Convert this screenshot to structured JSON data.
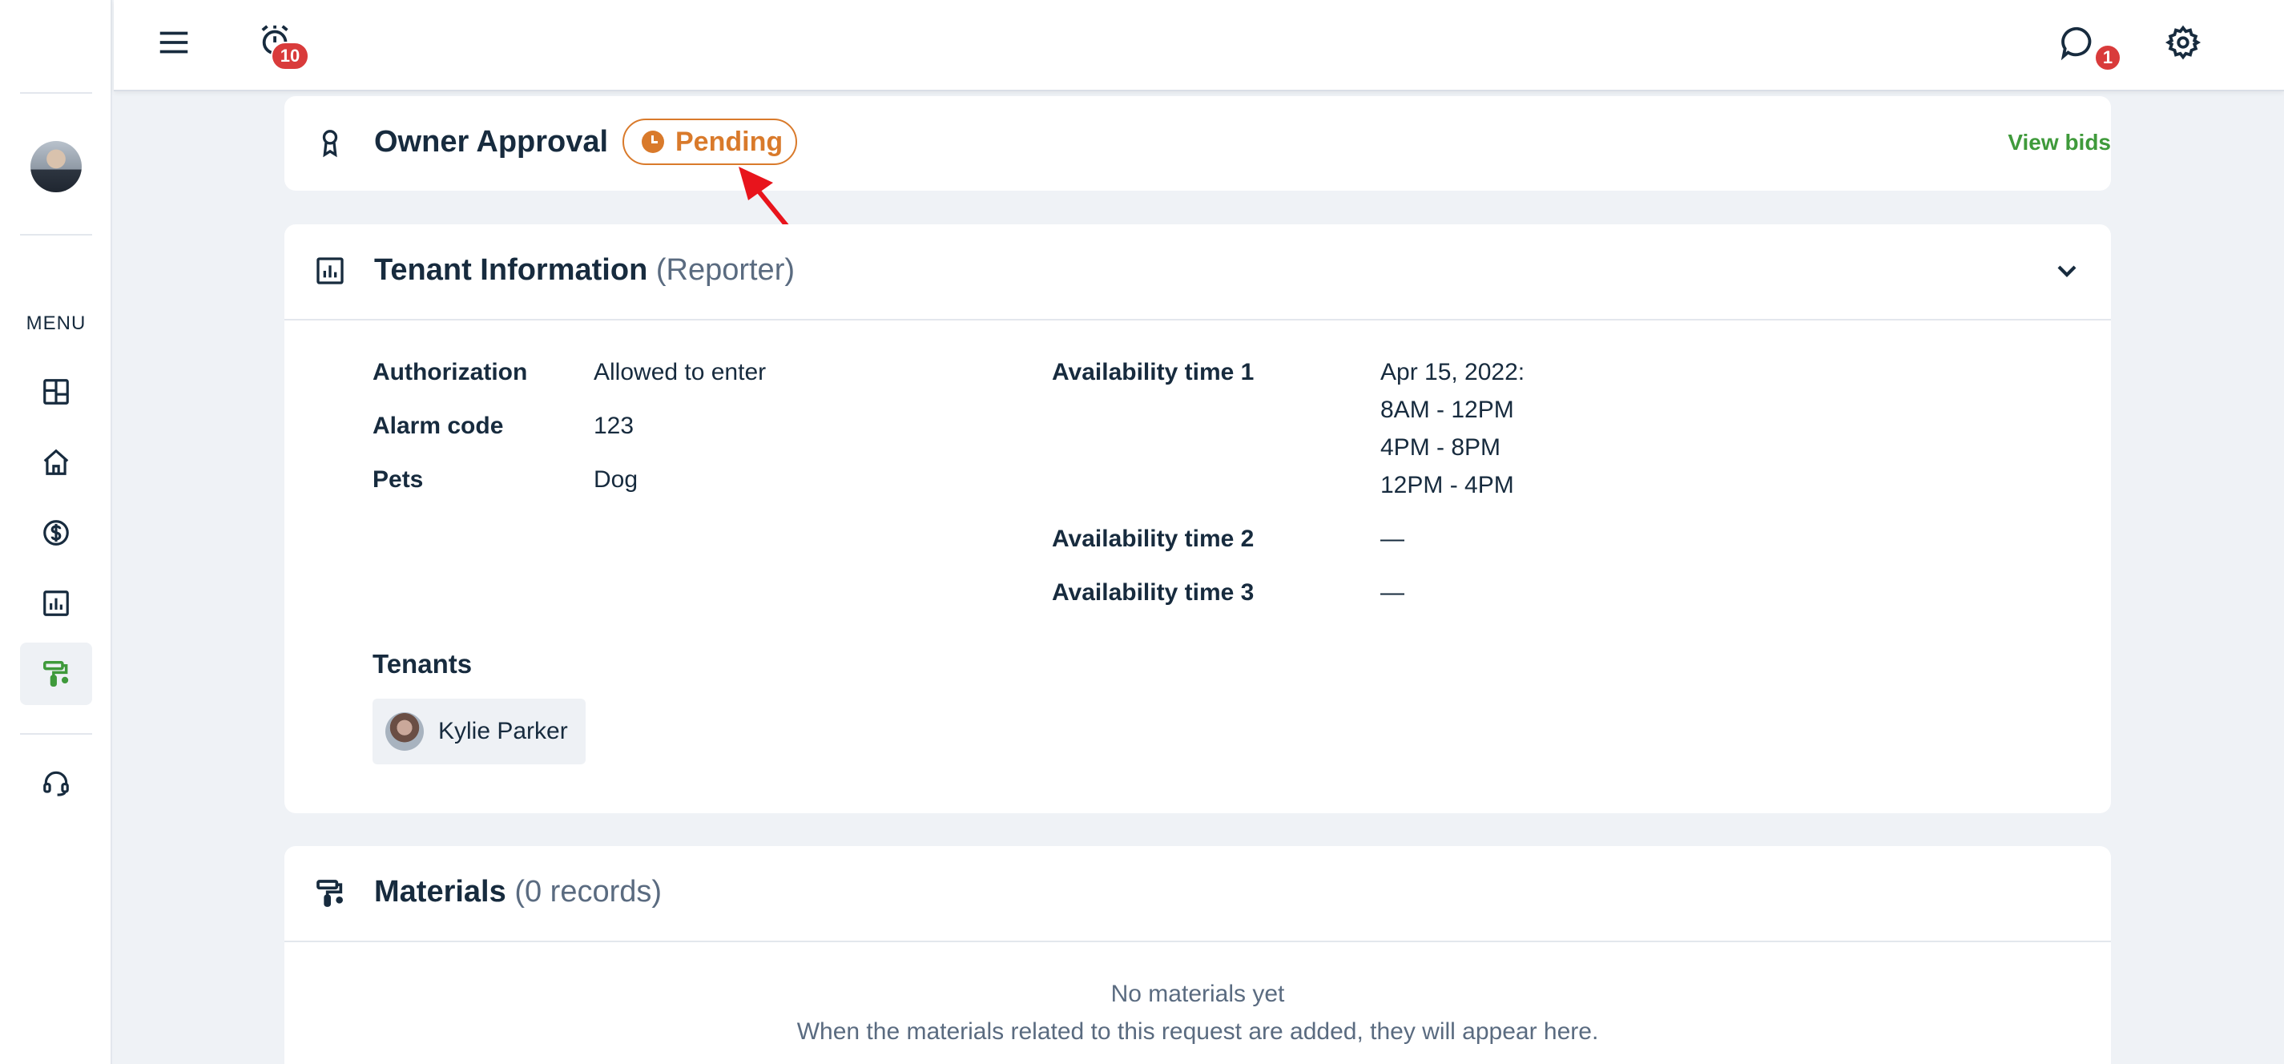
{
  "sidebar": {
    "menu_label": "MENU",
    "items": [
      {
        "icon": "dashboard-icon"
      },
      {
        "icon": "home-icon"
      },
      {
        "icon": "dollar-icon"
      },
      {
        "icon": "chart-icon"
      },
      {
        "icon": "paint-roller-icon",
        "active": true
      },
      {
        "icon": "headset-icon"
      }
    ]
  },
  "topbar": {
    "alarm_badge": "10",
    "chat_badge": "1"
  },
  "owner_approval": {
    "title": "Owner Approval",
    "status": "Pending",
    "status_color": "#d97a2b",
    "view_bids": "View bids"
  },
  "tenant_info": {
    "title": "Tenant Information",
    "subtitle": "(Reporter)",
    "authorization_label": "Authorization",
    "authorization_value": "Allowed to enter",
    "alarm_code_label": "Alarm code",
    "alarm_code_value": "123",
    "pets_label": "Pets",
    "pets_value": "Dog",
    "availability_1_label": "Availability time 1",
    "availability_1_lines": [
      "Apr 15, 2022:",
      "8AM - 12PM",
      "4PM - 8PM",
      "12PM - 4PM"
    ],
    "availability_2_label": "Availability time 2",
    "availability_2_value": "—",
    "availability_3_label": "Availability time 3",
    "availability_3_value": "—",
    "tenants_label": "Tenants",
    "tenant_name": "Kylie Parker"
  },
  "materials": {
    "title": "Materials",
    "subtitle": "(0 records)",
    "empty_title": "No materials yet",
    "empty_text": "When the materials related to this request are added, they will appear here."
  },
  "colors": {
    "accent_green": "#3f9a3b",
    "badge_red": "#d93b3b",
    "annotation_arrow": "#e8141c"
  }
}
